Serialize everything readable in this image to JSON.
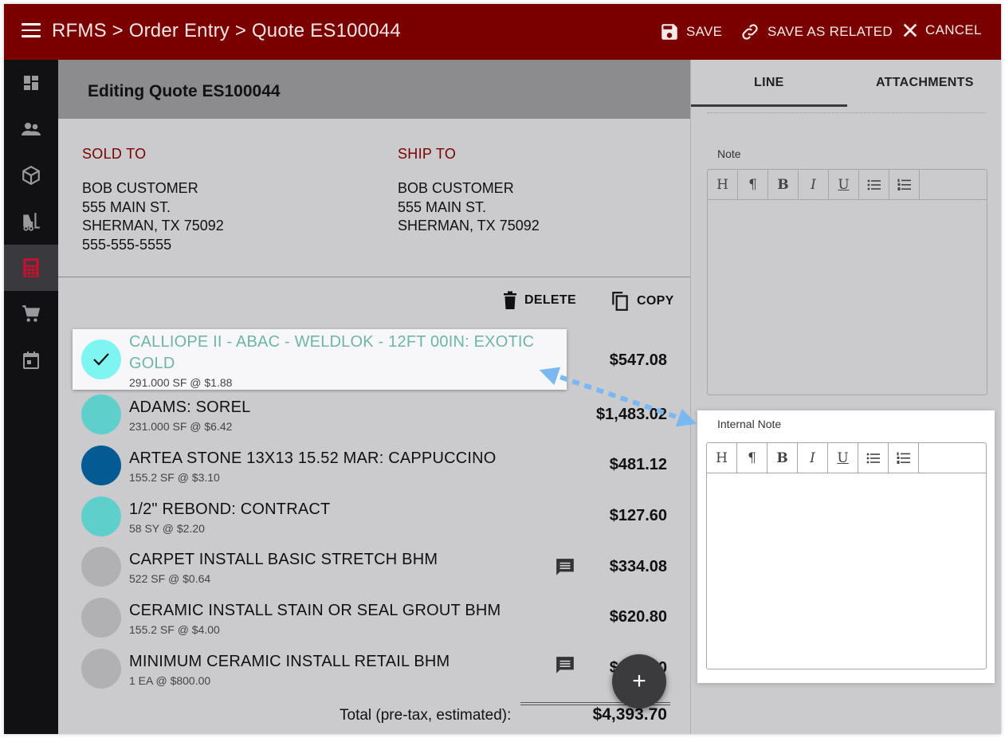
{
  "header": {
    "breadcrumb": "RFMS > Order Entry > Quote ES100044",
    "save_label": "SAVE",
    "save_related_label": "SAVE AS RELATED",
    "cancel_label": "CANCEL",
    "bar_color": "#7a0000"
  },
  "rail": {
    "items": [
      {
        "icon": "dashboard-icon"
      },
      {
        "icon": "people-icon"
      },
      {
        "icon": "box-icon"
      },
      {
        "icon": "forklift-icon"
      },
      {
        "icon": "calculator-icon",
        "active": true
      },
      {
        "icon": "cart-icon"
      },
      {
        "icon": "calendar-icon"
      }
    ]
  },
  "editing": {
    "title": "Editing Quote ES100044"
  },
  "sold_to": {
    "label": "SOLD TO",
    "name": "BOB CUSTOMER",
    "street": "555 MAIN ST.",
    "city": "SHERMAN, TX 75092",
    "phone": "555-555-5555"
  },
  "ship_to": {
    "label": "SHIP TO",
    "name": "BOB CUSTOMER",
    "street": "555 MAIN ST.",
    "city": "SHERMAN, TX 75092"
  },
  "actions": {
    "delete_label": "DELETE",
    "copy_label": "COPY"
  },
  "lines": [
    {
      "name": "CALLIOPE II - ABAC - WELDLOK - 12FT 00IN: EXOTIC",
      "name2": "GOLD",
      "detail": "291.000 SF @ $1.88",
      "price": "$547.08",
      "color": "#7ff5f2",
      "selected": true
    },
    {
      "name": "ADAMS: SOREL",
      "detail": "231.000 SF @ $6.42",
      "price": "$1,483.02",
      "color": "#5fcfcc"
    },
    {
      "name": "ARTEA STONE 13X13 15.52 MAR: CAPPUCCINO",
      "detail": "155.2 SF @ $3.10",
      "price": "$481.12",
      "color": "#045a92"
    },
    {
      "name": "1/2\" REBOND: CONTRACT",
      "detail": "58 SY @ $2.20",
      "price": "$127.60",
      "color": "#5fcfcc"
    },
    {
      "name": "CARPET INSTALL BASIC STRETCH BHM",
      "detail": "522 SF @ $0.64",
      "price": "$334.08",
      "color": "#b1b0b3",
      "note": true
    },
    {
      "name": "CERAMIC INSTALL STAIN OR SEAL GROUT BHM",
      "detail": "155.2 SF @ $4.00",
      "price": "$620.80",
      "color": "#b1b0b3"
    },
    {
      "name": "MINIMUM CERAMIC INSTALL RETAIL BHM",
      "detail": "1 EA @ $800.00",
      "price": "$800.00",
      "color": "#b1b0b3",
      "note": true
    }
  ],
  "total": {
    "label": "Total (pre-tax, estimated):",
    "value": "$4,393.70"
  },
  "right_panel": {
    "tab_line": "LINE",
    "tab_attachments": "ATTACHMENTS",
    "note_label": "Note",
    "internal_note_label": "Internal Note",
    "toolbar": [
      "H",
      "¶",
      "B",
      "I",
      "U",
      "bulleted-list-icon",
      "numbered-list-icon"
    ]
  },
  "colors": {
    "accent_red": "#7a0000",
    "selected_text": "#6fb5a6",
    "arrow_blue": "#7ab8f2"
  }
}
